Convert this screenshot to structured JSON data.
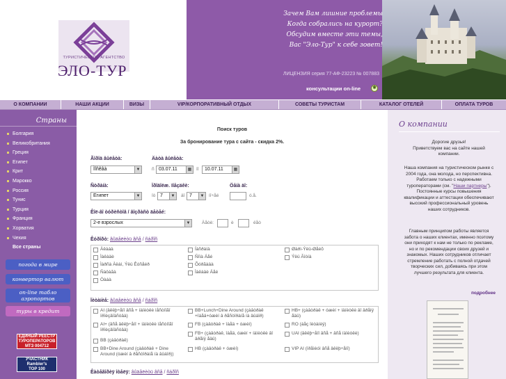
{
  "header": {
    "agency_small": "ТУРИСТИЧЕСКОЕ АГЕНТСТВО",
    "agency_name": "ЭЛО-ТУР",
    "slogan": [
      "Зачем Вам лишние проблемы",
      "Когда собрались на курорт?",
      "Обсудим вместе эти темы,",
      "Вас \"Эло-Тур\" к себе зовет!"
    ],
    "license": "ЛИЦЕНЗИЯ серия 77-АФ-23223 № 007883",
    "consult": "консультации on-line",
    "consult_icon": "globe-icon"
  },
  "nav": [
    "О КОМПАНИИ",
    "НАШИ АКЦИИ",
    "ВИЗЫ",
    "VIP/КОРПОРАТИВНЫЙ ОТДЫХ",
    "СОВЕТЫ ТУРИСТАМ",
    "КАТАЛОГ ОТЕЛЕЙ",
    "ОПЛАТА ТУРОВ"
  ],
  "sidebar": {
    "title": "Страны",
    "countries": [
      "Болгария",
      "Великобритания",
      "Греция",
      "Египет",
      "Крит",
      "Марокко",
      "Россия",
      "Тунис",
      "Турция",
      "Франция",
      "Хорватия",
      "Чехия"
    ],
    "all_countries": "Все страны",
    "buttons": [
      "погода в мире",
      "конвертор валют",
      "on-line табло аэропортов",
      "туры в кредит"
    ],
    "badge1": [
      "ЕДИНЫЙ РЕЕСТР",
      "ТУРОПЕРАТОРОВ",
      "МТЗ 004712"
    ],
    "badge2": [
      "УЧАСТНИК",
      "Rambler's",
      "TOP 100"
    ]
  },
  "search": {
    "title": "Поиск туров",
    "subtitle": "За бронирование тура с сайта - скидка 2%.",
    "tour_label": "Ãîðîä âûëåòà:",
    "tour_value": "Ìîñêâà",
    "dates_label": "Äàòà âûëåòà:",
    "date_from_prefix": "ñ",
    "date_from": "03.07.11",
    "date_to_prefix": "ïî",
    "date_to": "10.07.11",
    "country_label": "Ñòðàíà:",
    "country_value": "Египет",
    "nights_label": "Ïðîäîëæ. ïîåçäêè:",
    "nights_from_prefix": "îò",
    "nights_from": "7",
    "nights_to_prefix": "äî",
    "nights_to": "7",
    "nights_unit": "íî÷åé",
    "price_label": "Öåíà äî:",
    "price_unit": "ó.å.",
    "people_label": "Êîë-âî òóðèñòîâ / âîçðàñò äåòåé:",
    "people_value": "2-е взрослых",
    "child_label": "Äåòè:",
    "child_sep": "è",
    "child_unit": "ëåò",
    "resorts_label": "Êóðîðò:",
    "hotels_label": "Ïèòàíèå:",
    "category_label": "Êàòåãîðèÿ îòåëÿ:",
    "select_all": "âûäåëèòü âñå",
    "clear": "ñáðîñ",
    "resorts": [
      "Àêàáà",
      "Íàñðàíà",
      "Øàðì-Ýëü-Øåéõ",
      "Ìàêàäè",
      "Ñîìà Áåé",
      "Ýëü Ãîóíà",
      "Ìàðñà Àëàì, Ýëü Êóñåéð",
      "Õóðãàäà",
      "Ñàôàãà",
      "Ìàêàäè Áåé",
      "Òàáà"
    ],
    "meals": [
      "AI (âêëþ÷åíî âñå + íàïèòêè ìåñòíîãî ïðîèçâîäñòâà)",
      "AI+ (âñå âêëþ÷åíî + íàïèòêè ìåñòíîãî ïðîèçâîäñòâà)",
      "BB (çàâòðàê)",
      "BB+Dine Around (çàâòðàê + Dine Around (óæèí â ðåñòîðàíå íà âûáîð))",
      "BB+Lunch+Dine Around (çàâòðàê +îáåä+óæèí â ðåñòîðàíå íà âûáîð)",
      "FB (çàâòðàê + îáåä + óæèí)",
      "FB+ (çàâòðàê, îáåä, óæèí + íàïèòêè âî âðåìÿ åäû)",
      "HB (çàâòðàê + óæèí)",
      "HB+ (çàâòðàê + óæèí + íàïèòêè âî âðåìÿ åäû)",
      "RO (áåç ïèòàíèÿ)",
      "UAI (âêëþ÷åíî âñå + âñå íàïèòêè)",
      "VIP AI (ïðåìèóì âñå âêëþ÷åíî)"
    ]
  },
  "right": {
    "title": "О компании",
    "greeting": [
      "Дорогие друзья!",
      "Приветствуем вас на сайте нашей",
      "компании."
    ],
    "p1": [
      "Наша компания на туристическом рынке с",
      "2004 года, она молода,     но перспективна.",
      "Работаем только с надежными",
      "туроператорами (см. \"  Наши партнеры  \").",
      "Постоянные курсы повышения",
      "квалификации и аттестации обеспечивают",
      "высокий профессиональный уровень",
      "наших сотрудников."
    ],
    "partners_link": "Наши партнеры",
    "p2": [
      "Главным принципом работы является",
      "забота о наших клиентах,     именно поэтому",
      "они приходят к нам не только по рекламе,",
      "но и по рекомендации       своих друзей и",
      "знакомых. Наших сотрудников отличает",
      "стремление работать с полной       отдачей",
      "творческих сил, добиваясь при этом",
      "лучшего результата для клиента."
    ],
    "more": "подробнее"
  },
  "colors": {
    "brand": "#8e5aa8",
    "nav": "#c5afd3",
    "sidebar": "#8a5ca6",
    "btn_blue": "#4b5fc4",
    "btn_pink": "#c06ac0"
  }
}
